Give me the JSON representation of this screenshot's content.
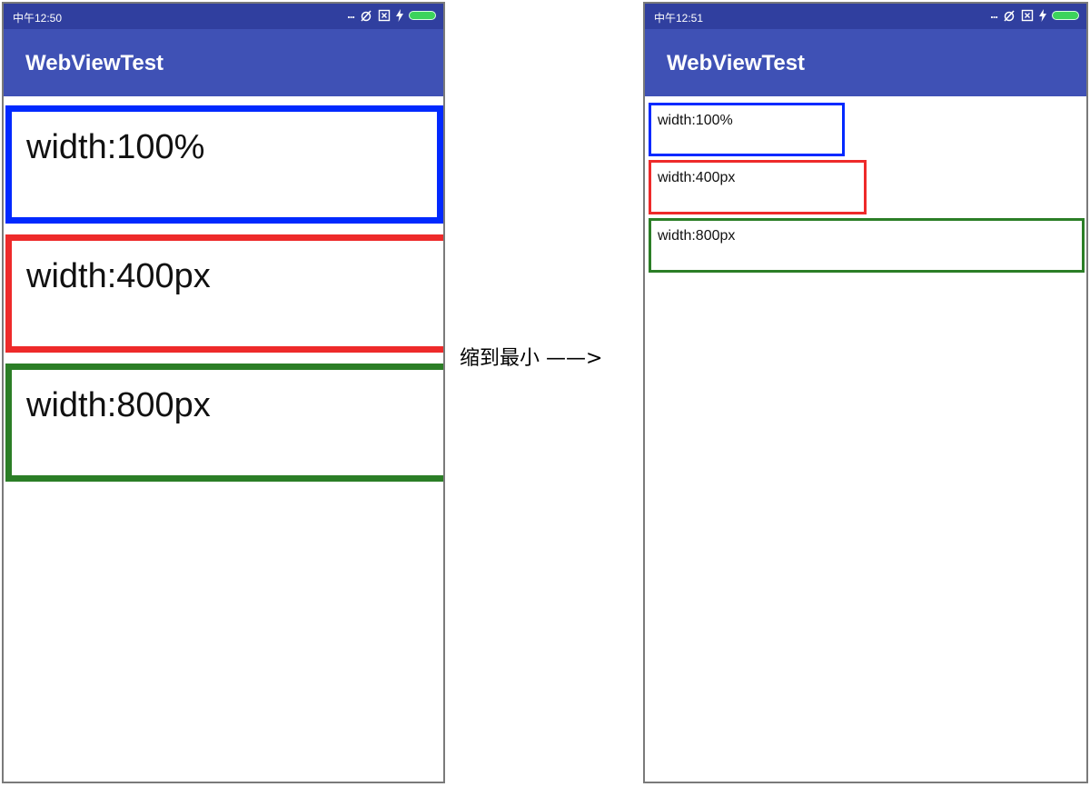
{
  "left_screen": {
    "status_time": "中午12:50",
    "status_dots": "...",
    "app_title": "WebViewTest",
    "boxes": [
      "width:100%",
      "width:400px",
      "width:800px"
    ]
  },
  "right_screen": {
    "status_time": "中午12:51",
    "status_dots": "...",
    "app_title": "WebViewTest",
    "boxes": [
      "width:100%",
      "width:400px",
      "width:800px"
    ]
  },
  "arrow_label": "缩到最小 ——>",
  "colors": {
    "status_bar": "#303f9f",
    "app_bar": "#3f51b5",
    "box_100": "#0029ff",
    "box_400": "#ee2a2a",
    "box_800": "#2b7e26"
  },
  "status_icons": [
    "mute-alarm-icon",
    "sim-x-icon",
    "charging-bolt-icon",
    "battery-icon"
  ]
}
